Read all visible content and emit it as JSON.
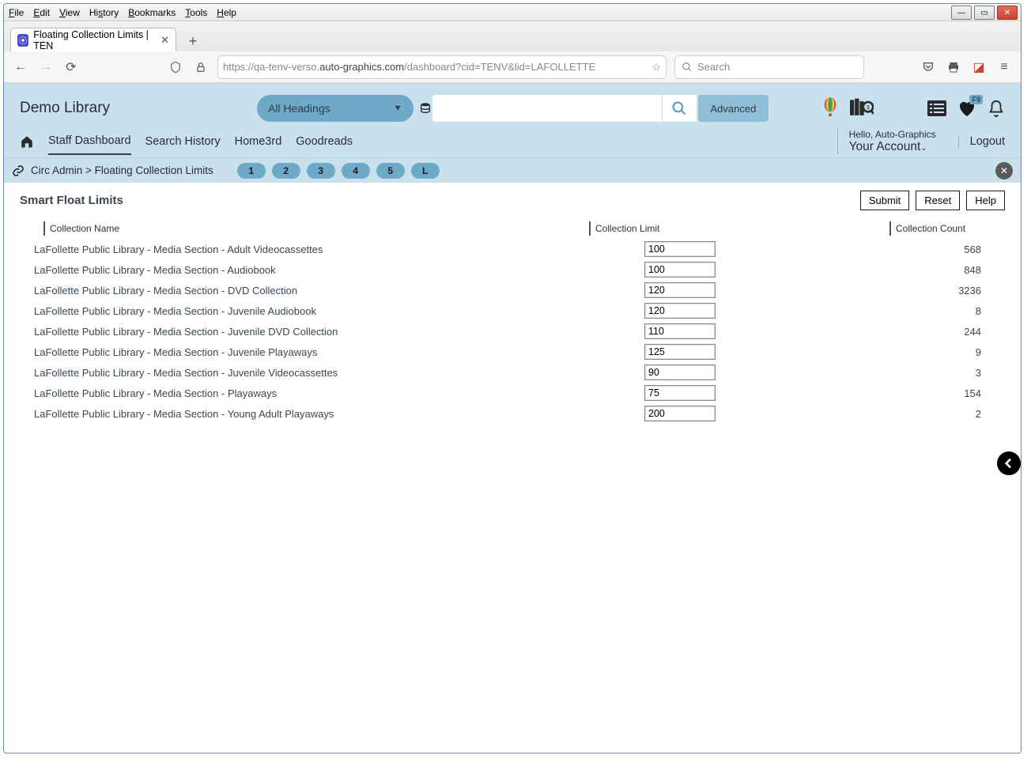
{
  "browser": {
    "menu": [
      "File",
      "Edit",
      "View",
      "History",
      "Bookmarks",
      "Tools",
      "Help"
    ],
    "tab_title": "Floating Collection Limits | TEN",
    "url_prefix": "https://qa-tenv-verso.",
    "url_bold": "auto-graphics.com",
    "url_suffix": "/dashboard?cid=TENV&lid=LAFOLLETTE",
    "search_placeholder": "Search"
  },
  "app": {
    "site_title": "Demo Library",
    "heading_label": "All Headings",
    "advanced_label": "Advanced",
    "fav_badge": "F9",
    "nav": {
      "staff": "Staff Dashboard",
      "history": "Search History",
      "home3rd": "Home3rd",
      "goodreads": "Goodreads"
    },
    "hello": "Hello, Auto-Graphics",
    "your_account": "Your Account",
    "logout": "Logout"
  },
  "crumb": {
    "text": "Circ Admin > Floating Collection Limits",
    "pages": [
      "1",
      "2",
      "3",
      "4",
      "5",
      "L"
    ]
  },
  "page": {
    "title": "Smart Float Limits",
    "submit": "Submit",
    "reset": "Reset",
    "help": "Help",
    "headers": {
      "name": "Collection Name",
      "limit": "Collection Limit",
      "count": "Collection Count"
    },
    "rows": [
      {
        "name": "LaFollette Public Library - Media Section - Adult Videocassettes",
        "limit": "100",
        "count": "568"
      },
      {
        "name": "LaFollette Public Library - Media Section - Audiobook",
        "limit": "100",
        "count": "848"
      },
      {
        "name": "LaFollette Public Library - Media Section - DVD Collection",
        "limit": "120",
        "count": "3236"
      },
      {
        "name": "LaFollette Public Library - Media Section - Juvenile Audiobook",
        "limit": "120",
        "count": "8"
      },
      {
        "name": "LaFollette Public Library - Media Section - Juvenile DVD Collection",
        "limit": "110",
        "count": "244"
      },
      {
        "name": "LaFollette Public Library - Media Section - Juvenile Playaways",
        "limit": "125",
        "count": "9"
      },
      {
        "name": "LaFollette Public Library - Media Section - Juvenile Videocassettes",
        "limit": "90",
        "count": "3"
      },
      {
        "name": "LaFollette Public Library - Media Section - Playaways",
        "limit": "75",
        "count": "154"
      },
      {
        "name": "LaFollette Public Library - Media Section - Young Adult Playaways",
        "limit": "200",
        "count": "2"
      }
    ]
  }
}
